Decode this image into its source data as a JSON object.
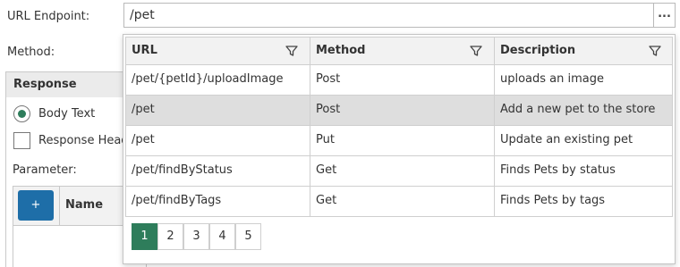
{
  "form": {
    "url_label": "URL Endpoint:",
    "url_value": "/pet",
    "url_button": "...",
    "method_label": "Method:",
    "response_title": "Response",
    "body_text_label": "Body Text",
    "response_headers_label": "Response Head",
    "parameter_label": "Parameter:",
    "add_button": "+",
    "name_column": "Name"
  },
  "dropdown": {
    "columns": [
      "URL",
      "Method",
      "Description"
    ],
    "rows": [
      {
        "url": "/pet/{petId}/uploadImage",
        "method": "Post",
        "description": "uploads an image",
        "selected": false
      },
      {
        "url": "/pet",
        "method": "Post",
        "description": "Add a new pet to the store",
        "selected": true
      },
      {
        "url": "/pet",
        "method": "Put",
        "description": "Update an existing pet",
        "selected": false
      },
      {
        "url": "/pet/findByStatus",
        "method": "Get",
        "description": "Finds Pets by status",
        "selected": false
      },
      {
        "url": "/pet/findByTags",
        "method": "Get",
        "description": "Finds Pets by tags",
        "selected": false
      }
    ],
    "pages": [
      "1",
      "2",
      "3",
      "4",
      "5"
    ],
    "active_page": "1"
  },
  "colors": {
    "accent": "#2e7d5b",
    "add_button": "#1e6ea8",
    "selected_row": "#dedede",
    "header_bg": "#f2f2f2"
  }
}
